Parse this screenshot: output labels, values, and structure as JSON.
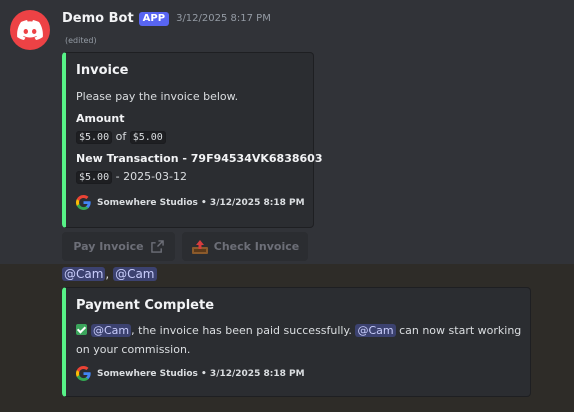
{
  "message": {
    "author": "Demo Bot",
    "badge": "APP",
    "timestamp": "3/12/2025 8:17 PM",
    "edited": "(edited)"
  },
  "invoice_embed": {
    "title": "Invoice",
    "description": "Please pay the invoice below.",
    "amount_label": "Amount",
    "amount_paid": "$5.00",
    "amount_of": "of",
    "amount_total": "$5.00",
    "transaction_label": "New Transaction - 79F94534VK6838603",
    "transaction_amount": "$5.00",
    "transaction_date": "- 2025-03-12",
    "footer": "Somewhere Studios • 3/12/2025 8:18 PM"
  },
  "buttons": {
    "pay_invoice": "Pay Invoice",
    "check_invoice": "Check Invoice"
  },
  "mentions_line": {
    "mention1": "@Cam",
    "separator": ",",
    "mention2": "@Cam"
  },
  "payment_embed": {
    "title": "Payment Complete",
    "mention1": "@Cam",
    "text1": ", the invoice has been paid successfully.",
    "mention2": "@Cam",
    "text2": "can now start working",
    "text3": "on your commission.",
    "footer": "Somewhere Studios • 3/12/2025 8:18 PM"
  },
  "colors": {
    "accent": "#57f287",
    "brand": "#5865f2",
    "avatar": "#ed4245"
  }
}
